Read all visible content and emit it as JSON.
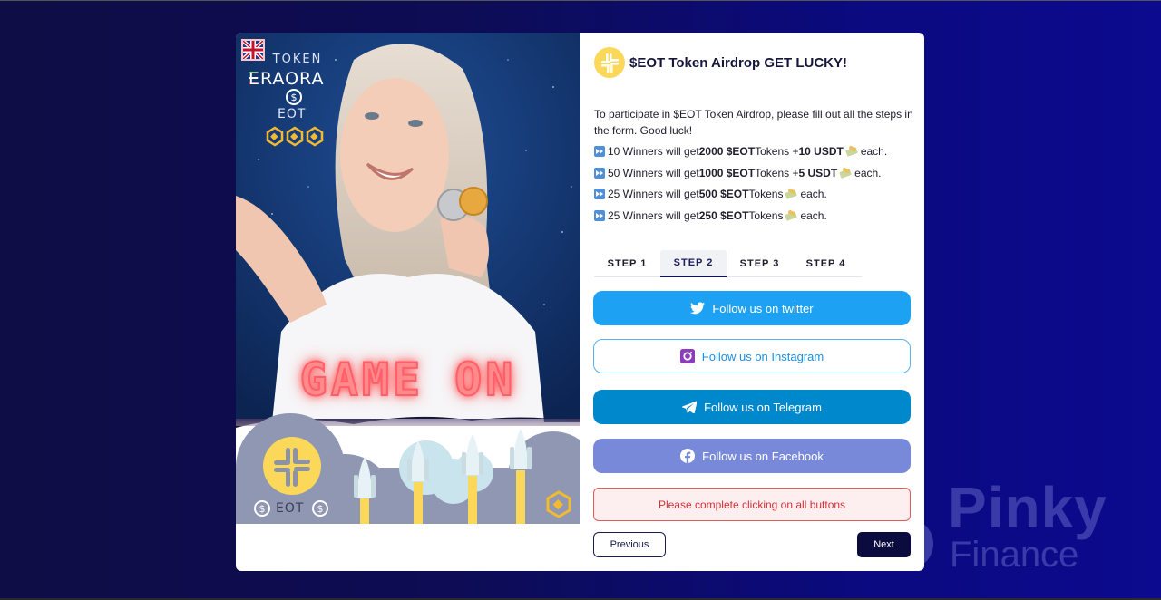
{
  "watermark": {
    "line1": "Pinky",
    "line2": "Finance"
  },
  "banner": {
    "language_flag": "uk-flag",
    "brand_token": "TOKEN",
    "brand_name": "ERAORA",
    "brand_ticker": "EOT",
    "headline": "GAME ON",
    "bottom_ticker": "EOT"
  },
  "panel": {
    "title": "$EOT Token Airdrop GET LUCKY!",
    "intro": "To participate in $EOT Token Airdrop, please fill out all the steps in the form. Good luck!",
    "prizes": [
      {
        "pre": "10 Winners will get ",
        "tokens": "2000 $EOT",
        "mid": " Tokens + ",
        "usdt": "10 USDT",
        "post": " each."
      },
      {
        "pre": "50 Winners will get ",
        "tokens": "1000 $EOT",
        "mid": " Tokens + ",
        "usdt": "5 USDT",
        "post": " each."
      },
      {
        "pre": "25 Winners will get ",
        "tokens": "500 $EOT",
        "mid": " Tokens",
        "usdt": "",
        "post": " each."
      },
      {
        "pre": "25 Winners will get ",
        "tokens": "250 $EOT",
        "mid": " Tokens",
        "usdt": "",
        "post": " each."
      }
    ],
    "tabs": [
      {
        "label": "STEP 1",
        "active": false
      },
      {
        "label": "STEP 2",
        "active": true
      },
      {
        "label": "STEP 3",
        "active": false
      },
      {
        "label": "STEP 4",
        "active": false
      }
    ],
    "buttons": {
      "twitter": "Follow us on twitter",
      "instagram": "Follow us on Instagram",
      "telegram": "Follow us on Telegram",
      "facebook": "Follow us on Facebook"
    },
    "alert": "Please complete clicking on all buttons",
    "previous": "Previous",
    "next": "Next"
  },
  "colors": {
    "twitter": "#1da1f2",
    "instagram_text": "#1d8fe0",
    "telegram": "#0088cc",
    "facebook": "#7789d8",
    "alert_text": "#d42f35",
    "next_bg": "#0b0b3f"
  }
}
